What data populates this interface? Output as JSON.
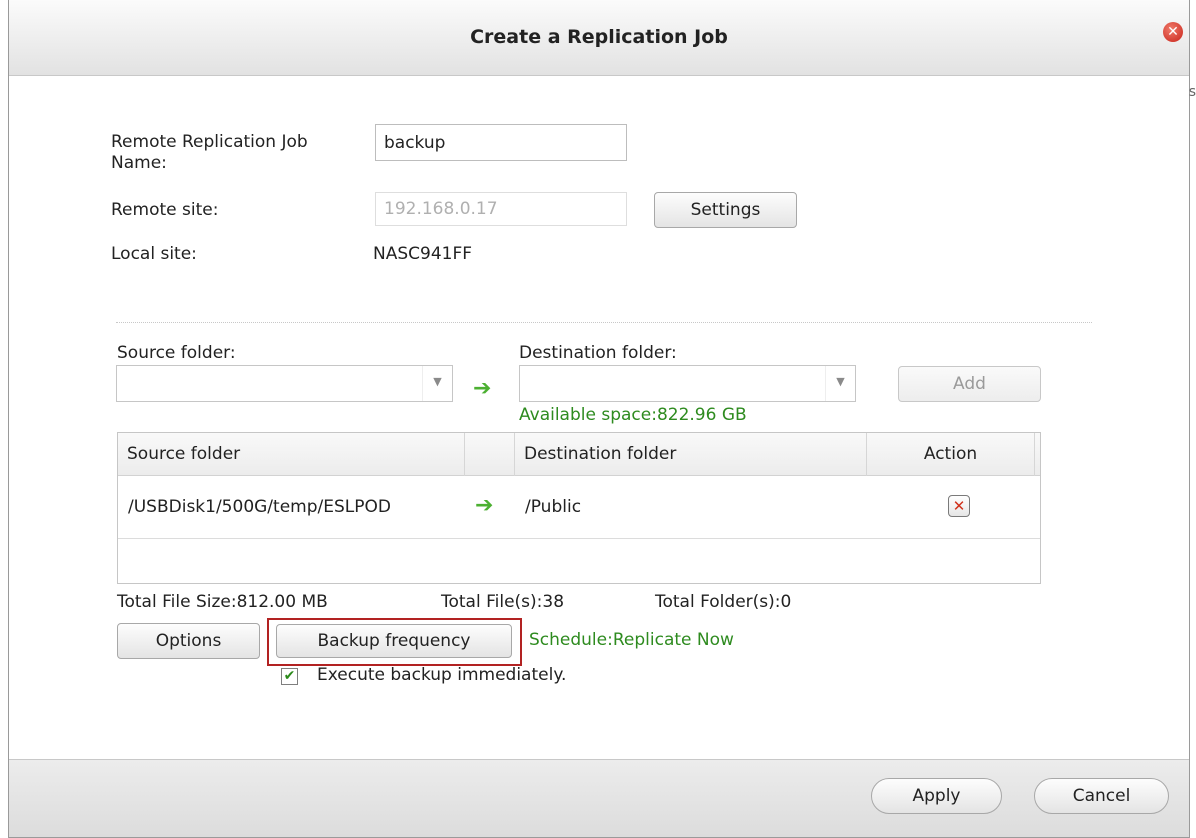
{
  "dialog": {
    "title": "Create a Replication Job",
    "close_icon": "close-icon"
  },
  "form": {
    "job_name_label_line1": "Remote Replication Job",
    "job_name_label_line2": "Name:",
    "job_name_value": "backup",
    "remote_site_label": "Remote site:",
    "remote_site_value": "192.168.0.17",
    "settings_label": "Settings",
    "local_site_label": "Local site:",
    "local_site_value": "NASC941FF"
  },
  "folders": {
    "source_label": "Source folder:",
    "destination_label": "Destination folder:",
    "source_value": "",
    "destination_value": "",
    "add_label": "Add",
    "available_space": "Available space:822.96 GB"
  },
  "table": {
    "columns": [
      "Source folder",
      "",
      "Destination folder",
      "Action"
    ],
    "rows": [
      {
        "source": "/USBDisk1/500G/temp/ESLPOD",
        "destination": "/Public"
      }
    ]
  },
  "summary": {
    "total_size": "Total File Size:812.00 MB",
    "total_files": "Total File(s):38",
    "total_folders": "Total Folder(s):0"
  },
  "actions": {
    "options_label": "Options",
    "backup_frequency_label": "Backup frequency",
    "schedule_text": "Schedule:Replicate Now",
    "execute_label": "Execute backup immediately.",
    "execute_checked": true
  },
  "footer": {
    "apply_label": "Apply",
    "cancel_label": "Cancel"
  },
  "edge_char": "s",
  "colors": {
    "accent_green": "#2e8b1f",
    "arrow_green": "#4cb032",
    "highlight_red": "#b22222",
    "close_red": "#c8231a"
  }
}
